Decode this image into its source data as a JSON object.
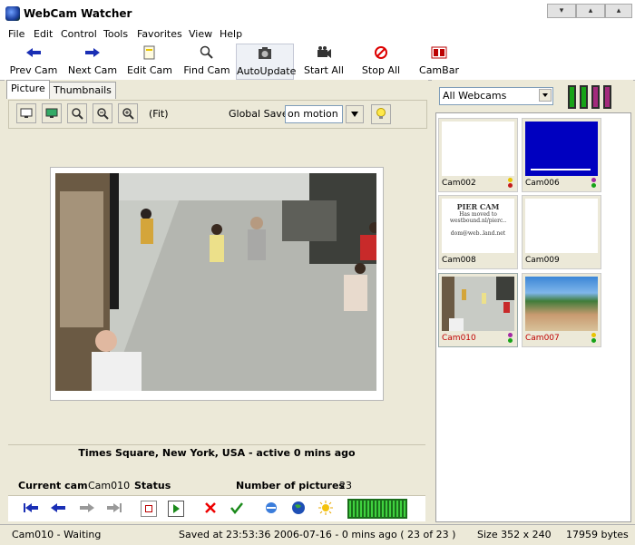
{
  "window": {
    "title": "WebCam Watcher"
  },
  "menu": [
    "File",
    "Edit",
    "Control",
    "Tools",
    "Favorites",
    "View",
    "Help"
  ],
  "toolbar": {
    "prev_cam": "Prev Cam",
    "next_cam": "Next Cam",
    "edit_cam": "Edit Cam",
    "find_cam": "Find Cam",
    "auto_update": "AutoUpdate",
    "start_all": "Start All",
    "stop_all": "Stop All",
    "cambar": "CamBar"
  },
  "tabs": {
    "picture": "Picture",
    "thumbnails": "Thumbnails"
  },
  "picture_toolbar": {
    "fit_label": "(Fit)",
    "global_save_label": "Global Save",
    "global_save_value": "on motion"
  },
  "info": {
    "location": "Times Square, New York, USA - active 0 mins ago",
    "current_cam_label": "Current cam",
    "current_cam_value": "Cam010",
    "status_label": "Status",
    "num_pictures_label": "Number of pictures",
    "num_pictures_value": "23"
  },
  "right_panel": {
    "filter_value": "All Webcams"
  },
  "thumbnails": [
    {
      "name": "Cam002",
      "image": "blank-white",
      "name_color": "#000000"
    },
    {
      "name": "Cam006",
      "image": "blue-screen",
      "name_color": "#000000"
    },
    {
      "name": "Cam008",
      "image": "text-page",
      "name_color": "#000000",
      "image_lines": [
        "PIER CAM",
        "Has moved to",
        "westbound.nl/pierc..",
        "",
        "dom@web..land.net"
      ]
    },
    {
      "name": "Cam009",
      "image": "blank-white",
      "name_color": "#000000"
    },
    {
      "name": "Cam010",
      "image": "street-scene",
      "name_color": "#c00000"
    },
    {
      "name": "Cam007",
      "image": "beach-scene",
      "name_color": "#c00000"
    }
  ],
  "status_bar": {
    "cam_status": "Cam010 - Waiting",
    "saved_info": "Saved at 23:53:36 2006-07-16 - 0 mins ago ( 23 of 23 )",
    "size": "Size 352 x 240",
    "bytes": "17959 bytes"
  },
  "colors": {
    "accent": "#0a246a",
    "active_name": "#c00000",
    "meter_green": "#1fa21f"
  }
}
